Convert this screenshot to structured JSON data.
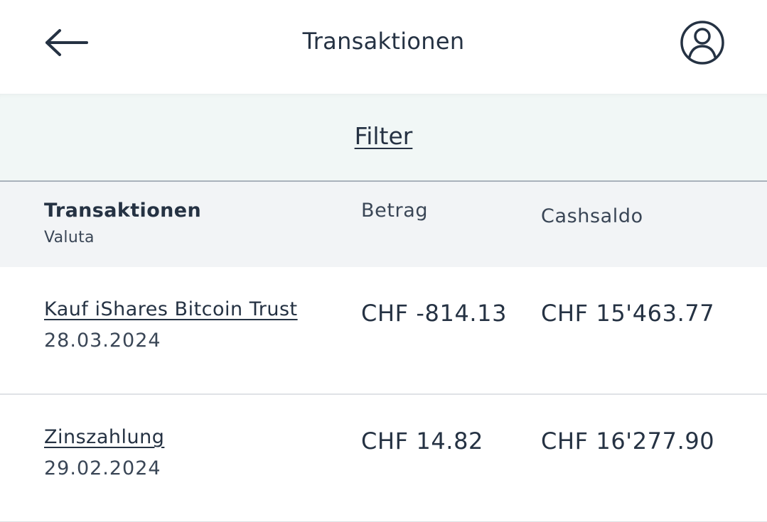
{
  "header": {
    "title": "Transaktionen",
    "back_icon": "arrow-left-icon",
    "profile_icon": "user-circle-icon"
  },
  "filter": {
    "label": "Filter"
  },
  "table": {
    "columns": {
      "transactions": "Transaktionen",
      "currency": "Valuta",
      "amount": "Betrag",
      "cash_balance": "Cashsaldo"
    },
    "rows": [
      {
        "title": "Kauf iShares Bitcoin Trust",
        "date": "28.03.2024",
        "amount": "CHF -814.13",
        "balance": "CHF 15'463.77"
      },
      {
        "title": "Zinszahlung",
        "date": "29.02.2024",
        "amount": "CHF 14.82",
        "balance": "CHF 16'277.90"
      }
    ]
  },
  "colors": {
    "text": "#253243",
    "filter_background": "#f1f7f6",
    "table_header_background": "#f2f4f6",
    "divider": "#dfe2e6"
  }
}
